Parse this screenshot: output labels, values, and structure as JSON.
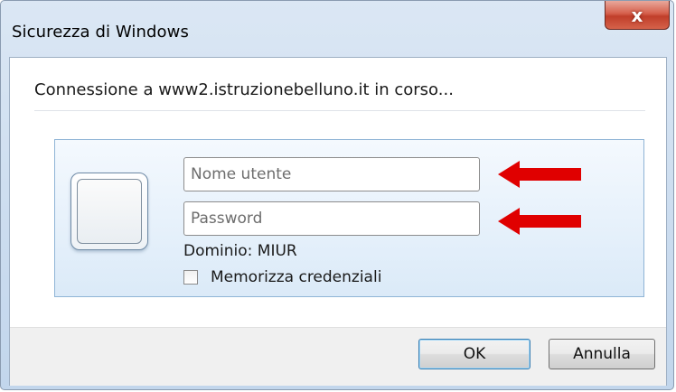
{
  "window": {
    "title": "Sicurezza di Windows",
    "close_label": "x"
  },
  "dialog": {
    "connecting_text": "Connessione a www2.istruzionebelluno.it in corso...",
    "username_placeholder": "Nome utente",
    "password_placeholder": "Password",
    "domain_text": "Dominio: MIUR",
    "remember_label": "Memorizza credenziali",
    "remember_checked": false
  },
  "buttons": {
    "ok_label": "OK",
    "cancel_label": "Annulla"
  },
  "annotations": {
    "arrow_color": "#e00000",
    "arrow_targets": [
      "username-field",
      "password-field"
    ]
  },
  "colors": {
    "panel_border": "#8fb4d6",
    "close_button": "#c8462f"
  }
}
